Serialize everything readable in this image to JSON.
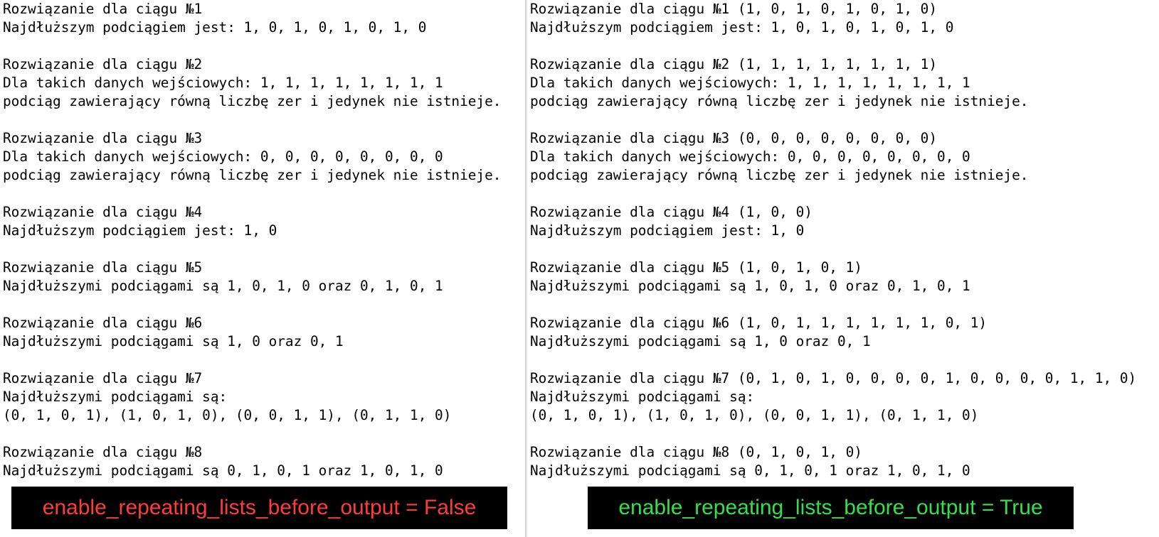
{
  "left": {
    "blocks": [
      {
        "lines": [
          "Rozwiązanie dla ciągu №1",
          "Najdłuższym podciągiem jest: 1, 0, 1, 0, 1, 0, 1, 0"
        ]
      },
      {
        "lines": [
          "Rozwiązanie dla ciągu №2",
          "Dla takich danych wejściowych: 1, 1, 1, 1, 1, 1, 1, 1",
          "podciąg zawierający równą liczbę zer i jedynek nie istnieje."
        ]
      },
      {
        "lines": [
          "Rozwiązanie dla ciągu №3",
          "Dla takich danych wejściowych: 0, 0, 0, 0, 0, 0, 0, 0",
          "podciąg zawierający równą liczbę zer i jedynek nie istnieje."
        ]
      },
      {
        "lines": [
          "Rozwiązanie dla ciągu №4",
          "Najdłuższym podciągiem jest: 1, 0"
        ]
      },
      {
        "lines": [
          "Rozwiązanie dla ciągu №5",
          "Najdłuższymi podciągami są 1, 0, 1, 0 oraz 0, 1, 0, 1"
        ]
      },
      {
        "lines": [
          "Rozwiązanie dla ciągu №6",
          "Najdłuższymi podciągami są 1, 0 oraz 0, 1"
        ]
      },
      {
        "lines": [
          "Rozwiązanie dla ciągu №7",
          "Najdłuższymi podciągami są:",
          "(0, 1, 0, 1), (1, 0, 1, 0), (0, 0, 1, 1), (0, 1, 1, 0)"
        ]
      },
      {
        "lines": [
          "Rozwiązanie dla ciągu №8",
          "Najdłuższymi podciągami są 0, 1, 0, 1 oraz 1, 0, 1, 0"
        ]
      }
    ],
    "banner": "enable_repeating_lists_before_output = False"
  },
  "right": {
    "blocks": [
      {
        "lines": [
          "Rozwiązanie dla ciągu №1 (1, 0, 1, 0, 1, 0, 1, 0)",
          "Najdłuższym podciągiem jest: 1, 0, 1, 0, 1, 0, 1, 0"
        ]
      },
      {
        "lines": [
          "Rozwiązanie dla ciągu №2 (1, 1, 1, 1, 1, 1, 1, 1)",
          "Dla takich danych wejściowych: 1, 1, 1, 1, 1, 1, 1, 1",
          "podciąg zawierający równą liczbę zer i jedynek nie istnieje."
        ]
      },
      {
        "lines": [
          "Rozwiązanie dla ciągu №3 (0, 0, 0, 0, 0, 0, 0, 0)",
          "Dla takich danych wejściowych: 0, 0, 0, 0, 0, 0, 0, 0",
          "podciąg zawierający równą liczbę zer i jedynek nie istnieje."
        ]
      },
      {
        "lines": [
          "Rozwiązanie dla ciągu №4 (1, 0, 0)",
          "Najdłuższym podciągiem jest: 1, 0"
        ]
      },
      {
        "lines": [
          "Rozwiązanie dla ciągu №5 (1, 0, 1, 0, 1)",
          "Najdłuższymi podciągami są 1, 0, 1, 0 oraz 0, 1, 0, 1"
        ]
      },
      {
        "lines": [
          "Rozwiązanie dla ciągu №6 (1, 0, 1, 1, 1, 1, 1, 1, 0, 1)",
          "Najdłuższymi podciągami są 1, 0 oraz 0, 1"
        ]
      },
      {
        "lines": [
          "Rozwiązanie dla ciągu №7 (0, 1, 0, 1, 0, 0, 0, 0, 1, 0, 0, 0, 0, 1, 1, 0)",
          "Najdłuższymi podciągami są:",
          "(0, 1, 0, 1), (1, 0, 1, 0), (0, 0, 1, 1), (0, 1, 1, 0)"
        ]
      },
      {
        "lines": [
          "Rozwiązanie dla ciągu №8 (0, 1, 0, 1, 0)",
          "Najdłuższymi podciągami są 0, 1, 0, 1 oraz 1, 0, 1, 0"
        ]
      }
    ],
    "banner": "enable_repeating_lists_before_output = True"
  },
  "colors": {
    "banner_false_text": "#ff3b3b",
    "banner_true_text": "#33e04a",
    "banner_background": "#000000"
  }
}
